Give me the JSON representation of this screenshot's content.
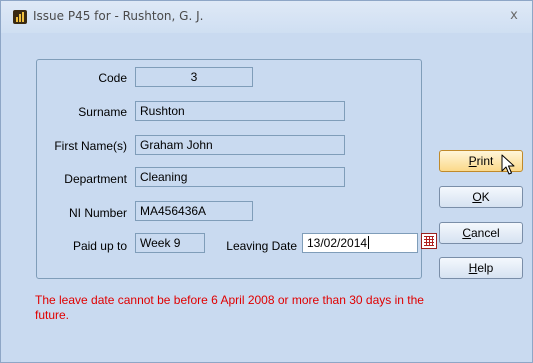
{
  "window": {
    "title": "Issue P45 for - Rushton, G. J.",
    "close_glyph": "x"
  },
  "form": {
    "code": {
      "label": "Code",
      "value": "3"
    },
    "surname": {
      "label": "Surname",
      "value": "Rushton"
    },
    "first_names": {
      "label": "First Name(s)",
      "value": "Graham John"
    },
    "department": {
      "label": "Department",
      "value": "Cleaning"
    },
    "ni_number": {
      "label": "NI Number",
      "value": "MA456436A"
    },
    "paid_up_to": {
      "label": "Paid up to",
      "value": "Week 9"
    },
    "leaving_date": {
      "label": "Leaving Date",
      "value": "13/02/2014"
    }
  },
  "error_message": "The leave date cannot be before 6 April 2008 or more than 30 days in the future.",
  "buttons": {
    "print": {
      "accel": "P",
      "rest": "rint"
    },
    "ok": {
      "accel": "O",
      "rest": "K"
    },
    "cancel": {
      "accel": "C",
      "rest": "ancel"
    },
    "help": {
      "accel": "H",
      "rest": "elp"
    }
  },
  "icons": {
    "app": "app-icon",
    "calendar": "calendar-icon",
    "cursor": "mouse-pointer-icon"
  },
  "colors": {
    "dialog_background": "#c9daf0",
    "error_text": "#e00000",
    "hot_button": "#fbd98a"
  }
}
